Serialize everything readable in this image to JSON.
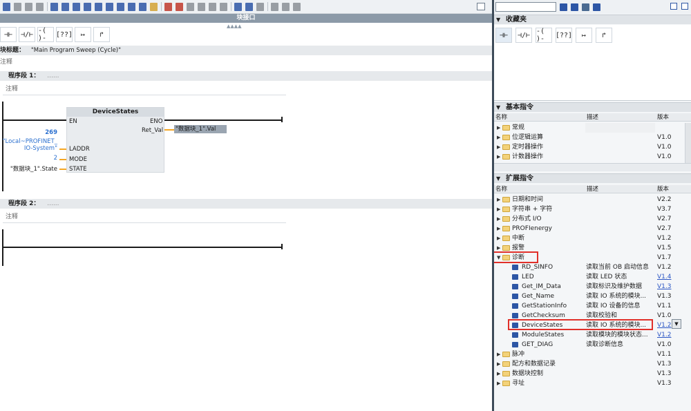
{
  "editor": {
    "block_interface_label": "块接口",
    "block_title_label": "块标题：",
    "block_title_value": "\"Main Program Sweep (Cycle)\"",
    "block_comment": "注释",
    "ladder_toolbar": [
      "⊣⊢",
      "⊣/⊢",
      "-( )-",
      "[??]",
      "↦",
      "↱"
    ],
    "networks": [
      {
        "title": "程序段 1：",
        "title_extra": "......",
        "comment": "注释",
        "block": {
          "name": "DeviceStates",
          "pin_en": "EN",
          "pin_eno": "ENO",
          "pin_retval": "Ret_Val",
          "pin_laddr": "LADDR",
          "pin_mode": "MODE",
          "pin_state": "STATE",
          "laddr_value": "269",
          "laddr_name_1": "\"Local~PROFINET_",
          "laddr_name_2": "IO-System\"",
          "mode_value": "2",
          "state_value": "\"数据块_1\".State",
          "retval_value": "\"数据块_1\".Val"
        }
      },
      {
        "title": "程序段 2：",
        "title_extra": "......",
        "comment": "注释"
      }
    ]
  },
  "panel": {
    "search_placeholder": "",
    "favorites": {
      "title": "收藏夹",
      "items": [
        "⊣⊢",
        "⊣/⊢",
        "-( )-",
        "[??]",
        "↦",
        "↱"
      ]
    },
    "basic": {
      "title": "基本指令",
      "columns": {
        "name": "名称",
        "desc": "描述",
        "version": "版本"
      },
      "rows": [
        {
          "name": "常规",
          "desc": "",
          "version": ""
        },
        {
          "name": "位逻辑运算",
          "desc": "",
          "version": "V1.0"
        },
        {
          "name": "定时器操作",
          "desc": "",
          "version": "V1.0"
        },
        {
          "name": "计数器操作",
          "desc": "",
          "version": "V1.0"
        }
      ]
    },
    "extended": {
      "title": "扩展指令",
      "columns": {
        "name": "名称",
        "desc": "描述",
        "version": "版本"
      },
      "folders_top": [
        {
          "name": "日期和时间",
          "version": "V2.2"
        },
        {
          "name": "字符串 + 字符",
          "version": "V3.7"
        },
        {
          "name": "分布式 I/O",
          "version": "V2.7"
        },
        {
          "name": "PROFIenergy",
          "version": "V2.7"
        },
        {
          "name": "中断",
          "version": "V1.2"
        },
        {
          "name": "报警",
          "version": "V1.5"
        }
      ],
      "expanded_folder": {
        "name": "诊断",
        "version": "V1.7"
      },
      "diag_items": [
        {
          "name": "RD_SINFO",
          "desc": "读取当前 OB 启动信息",
          "version": "V1.2",
          "link": false
        },
        {
          "name": "LED",
          "desc": "读取 LED 状态",
          "version": "V1.4",
          "link": true
        },
        {
          "name": "Get_IM_Data",
          "desc": "读取标识及维护数据",
          "version": "V1.3",
          "link": true
        },
        {
          "name": "Get_Name",
          "desc": "读取 IO 系统的模块...",
          "version": "V1.3",
          "link": false
        },
        {
          "name": "GetStationInfo",
          "desc": "读取 IO 设备的信息",
          "version": "V1.1",
          "link": false
        },
        {
          "name": "GetChecksum",
          "desc": "读取校验和",
          "version": "V1.0",
          "link": false
        },
        {
          "name": "DeviceStates",
          "desc": "读取 IO 系统的模块...",
          "version": "V1.2",
          "link": true
        },
        {
          "name": "ModuleStates",
          "desc": "读取模块的模块状态...",
          "version": "V1.2",
          "link": true
        },
        {
          "name": "GET_DIAG",
          "desc": "读取诊断信息",
          "version": "V1.0",
          "link": false
        }
      ],
      "folders_bottom": [
        {
          "name": "脉冲",
          "version": "V1.1"
        },
        {
          "name": "配方和数据记录",
          "version": "V1.3"
        },
        {
          "name": "数据块控制",
          "version": "V1.3"
        },
        {
          "name": "寻址",
          "version": "V1.3"
        }
      ]
    }
  },
  "colors": {
    "highlight_box": "#e0302a",
    "wire": "#f5a623",
    "interface_bar": "#8c9aa8",
    "link": "#2a55c4"
  }
}
